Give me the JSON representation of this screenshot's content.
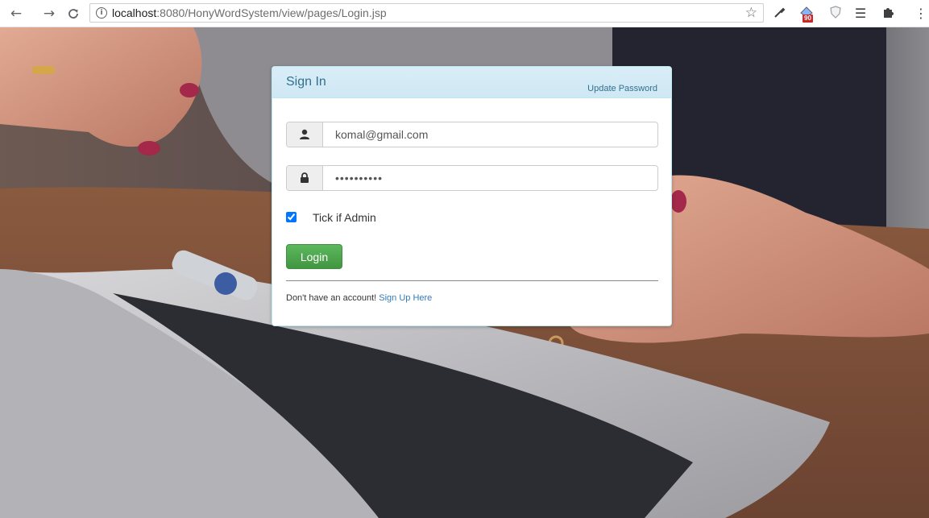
{
  "browser": {
    "url_host": "localhost",
    "url_path": ":8080/HonyWordSystem/view/pages/Login.jsp",
    "extension_badge": "90",
    "icons": [
      "back-arrow-icon",
      "forward-arrow-icon",
      "reload-icon",
      "info-icon",
      "star-icon",
      "eyedropper-icon",
      "extension-badge-icon",
      "shield-extension-icon",
      "list-extension-icon",
      "puzzle-extension-icon",
      "kebab-menu-icon"
    ]
  },
  "login": {
    "title": "Sign In",
    "update_password_link": "Update Password",
    "email_value": "komal@gmail.com",
    "password_value": "••••••••••",
    "admin_checkbox_label": "Tick if Admin",
    "admin_checked": true,
    "login_button": "Login",
    "no_account_text": "Don't have an account!",
    "signup_link": "Sign Up Here"
  },
  "colors": {
    "heading_bg": "#d9edf7",
    "heading_text": "#31708f",
    "login_button": "#5cb85c",
    "link": "#337ab7"
  }
}
